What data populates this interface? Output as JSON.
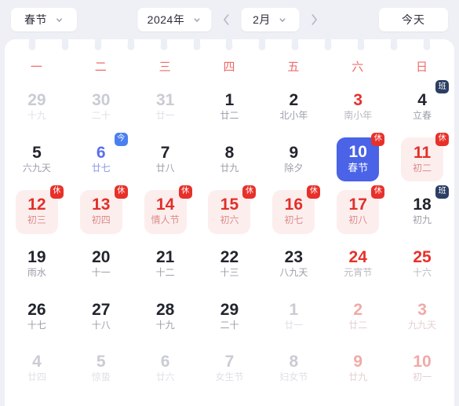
{
  "toolbar": {
    "festival_select": {
      "label": "春节",
      "icon": "chevron-down-icon"
    },
    "year_select": {
      "label": "2024年",
      "icon": "chevron-down-icon"
    },
    "month_select": {
      "label": "2月",
      "icon": "chevron-down-icon"
    },
    "prev_month": "chevron-left-icon",
    "next_month": "chevron-right-icon",
    "today_button": "今天"
  },
  "calendar": {
    "weekdays": [
      "一",
      "二",
      "三",
      "四",
      "五",
      "六",
      "日"
    ],
    "weekday_color": "#ef6b6b",
    "selected_color": "#4a63e7",
    "rest_badge_color": "#e8302a",
    "work_badge_color": "#2c3e63",
    "today_badge_color": "#4a7ff0",
    "rest_bg_color": "#fdeeee",
    "weeks": [
      [
        {
          "num": "29",
          "lunar": "十九",
          "variant": "v-out",
          "badge": ""
        },
        {
          "num": "30",
          "lunar": "二十",
          "variant": "v-out",
          "badge": ""
        },
        {
          "num": "31",
          "lunar": "廿一",
          "variant": "v-out",
          "badge": ""
        },
        {
          "num": "1",
          "lunar": "廿二",
          "variant": "",
          "badge": ""
        },
        {
          "num": "2",
          "lunar": "北小年",
          "variant": "",
          "badge": ""
        },
        {
          "num": "3",
          "lunar": "南小年",
          "variant": "v-red",
          "badge": ""
        },
        {
          "num": "4",
          "lunar": "立春",
          "variant": "",
          "badge": "班"
        }
      ],
      [
        {
          "num": "5",
          "lunar": "六九天",
          "variant": "",
          "badge": ""
        },
        {
          "num": "6",
          "lunar": "廿七",
          "variant": "v-today",
          "badge": "今"
        },
        {
          "num": "7",
          "lunar": "廿八",
          "variant": "",
          "badge": ""
        },
        {
          "num": "8",
          "lunar": "廿九",
          "variant": "",
          "badge": ""
        },
        {
          "num": "9",
          "lunar": "除夕",
          "variant": "",
          "badge": ""
        },
        {
          "num": "10",
          "lunar": "春节",
          "variant": "v-selected",
          "badge": "休"
        },
        {
          "num": "11",
          "lunar": "初二",
          "variant": "v-rest",
          "badge": "休"
        }
      ],
      [
        {
          "num": "12",
          "lunar": "初三",
          "variant": "v-rest",
          "badge": "休"
        },
        {
          "num": "13",
          "lunar": "初四",
          "variant": "v-rest",
          "badge": "休"
        },
        {
          "num": "14",
          "lunar": "情人节",
          "variant": "v-rest",
          "badge": "休"
        },
        {
          "num": "15",
          "lunar": "初六",
          "variant": "v-rest",
          "badge": "休"
        },
        {
          "num": "16",
          "lunar": "初七",
          "variant": "v-rest",
          "badge": "休"
        },
        {
          "num": "17",
          "lunar": "初八",
          "variant": "v-rest",
          "badge": "休"
        },
        {
          "num": "18",
          "lunar": "初九",
          "variant": "",
          "badge": "班"
        }
      ],
      [
        {
          "num": "19",
          "lunar": "雨水",
          "variant": "",
          "badge": ""
        },
        {
          "num": "20",
          "lunar": "十一",
          "variant": "",
          "badge": ""
        },
        {
          "num": "21",
          "lunar": "十二",
          "variant": "",
          "badge": ""
        },
        {
          "num": "22",
          "lunar": "十三",
          "variant": "",
          "badge": ""
        },
        {
          "num": "23",
          "lunar": "八九天",
          "variant": "",
          "badge": ""
        },
        {
          "num": "24",
          "lunar": "元宵节",
          "variant": "v-red",
          "badge": ""
        },
        {
          "num": "25",
          "lunar": "十六",
          "variant": "v-red",
          "badge": ""
        }
      ],
      [
        {
          "num": "26",
          "lunar": "十七",
          "variant": "",
          "badge": ""
        },
        {
          "num": "27",
          "lunar": "十八",
          "variant": "",
          "badge": ""
        },
        {
          "num": "28",
          "lunar": "十九",
          "variant": "",
          "badge": ""
        },
        {
          "num": "29",
          "lunar": "二十",
          "variant": "",
          "badge": ""
        },
        {
          "num": "1",
          "lunar": "廿一",
          "variant": "v-out",
          "badge": ""
        },
        {
          "num": "2",
          "lunar": "廿二",
          "variant": "v-out-red",
          "badge": ""
        },
        {
          "num": "3",
          "lunar": "九九天",
          "variant": "v-out-red",
          "badge": ""
        }
      ],
      [
        {
          "num": "4",
          "lunar": "廿四",
          "variant": "v-out",
          "badge": ""
        },
        {
          "num": "5",
          "lunar": "惊蛰",
          "variant": "v-out",
          "badge": ""
        },
        {
          "num": "6",
          "lunar": "廿六",
          "variant": "v-out",
          "badge": ""
        },
        {
          "num": "7",
          "lunar": "女生节",
          "variant": "v-out",
          "badge": ""
        },
        {
          "num": "8",
          "lunar": "妇女节",
          "variant": "v-out",
          "badge": ""
        },
        {
          "num": "9",
          "lunar": "廿九",
          "variant": "v-out-red",
          "badge": ""
        },
        {
          "num": "10",
          "lunar": "初一",
          "variant": "v-out-red",
          "badge": ""
        }
      ]
    ]
  }
}
